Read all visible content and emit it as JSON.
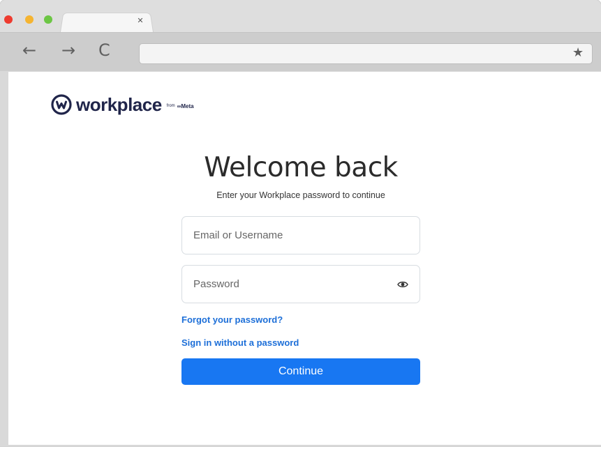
{
  "browser": {
    "tab_close_glyph": "✕",
    "nav": {
      "back_icon": "←",
      "forward_icon": "→",
      "reload_icon": "C",
      "star_icon": "★"
    },
    "url": ""
  },
  "brand": {
    "wordmark": "workplace",
    "from": "from",
    "meta": "∞Meta",
    "color": "#20254a"
  },
  "login": {
    "title": "Welcome back",
    "subtitle": "Enter your Workplace password to continue",
    "email_placeholder": "Email or Username",
    "password_placeholder": "Password",
    "forgot_link": "Forgot your password?",
    "passwordless_link": "Sign in without a password",
    "continue_label": "Continue",
    "accent_color": "#1877f2",
    "link_color": "#1d6fd8"
  }
}
